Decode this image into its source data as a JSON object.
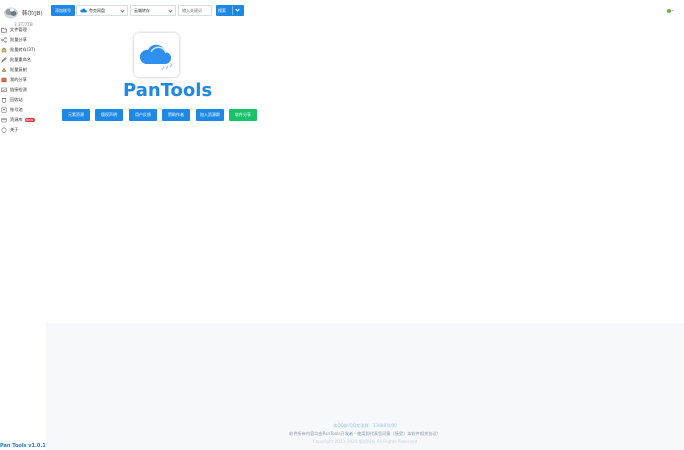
{
  "user": {
    "name": "韩尔(JB)",
    "usage": "3.3T/7TB"
  },
  "menu": [
    {
      "label": "文件管理",
      "icon": "folder-icon",
      "badge": ""
    },
    {
      "label": "批量分享",
      "icon": "share-icon",
      "badge": ""
    },
    {
      "label": "批量转存(37)",
      "icon": "transfer-icon",
      "badge": ""
    },
    {
      "label": "批量重命名",
      "icon": "rename-icon",
      "badge": ""
    },
    {
      "label": "批量复制",
      "icon": "copy-icon",
      "badge": ""
    },
    {
      "label": "我的分享",
      "icon": "my-share-icon",
      "badge": ""
    },
    {
      "label": "链接检测",
      "icon": "link-check-icon",
      "badge": ""
    },
    {
      "label": "回收站",
      "icon": "recycle-icon",
      "badge": ""
    },
    {
      "label": "账号池",
      "icon": "account-pool-icon",
      "badge": ""
    },
    {
      "label": "资源库",
      "icon": "library-icon",
      "badge": "NEW"
    },
    {
      "label": "关于",
      "icon": "about-icon",
      "badge": ""
    }
  ],
  "version": "Pan Tools v1.0.17",
  "toolbar": {
    "add_account": "添加账号",
    "drive": "夸克网盘",
    "type": "云端转存",
    "search_placeholder": "输入关键词",
    "search_label": "搜索"
  },
  "app": {
    "title": "PanTools"
  },
  "links": [
    {
      "label": "元素资源"
    },
    {
      "label": "版权声明"
    },
    {
      "label": "用户反馈"
    },
    {
      "label": "赞助作者"
    },
    {
      "label": "加入资源群"
    },
    {
      "label": "软件分享"
    }
  ],
  "footer": {
    "line1": "本QQ群/QQ交流群：136883000",
    "line2": "软件所有内容均由PanTools开发者 · 使用即代表您同意（接受）本软件相关协议！",
    "line3": "Copyright 2023-2024 版权所有 All Rights Reserved"
  },
  "colors": {
    "accent": "#1e88e5",
    "green": "#19c26a",
    "badge": "#e8363a"
  }
}
